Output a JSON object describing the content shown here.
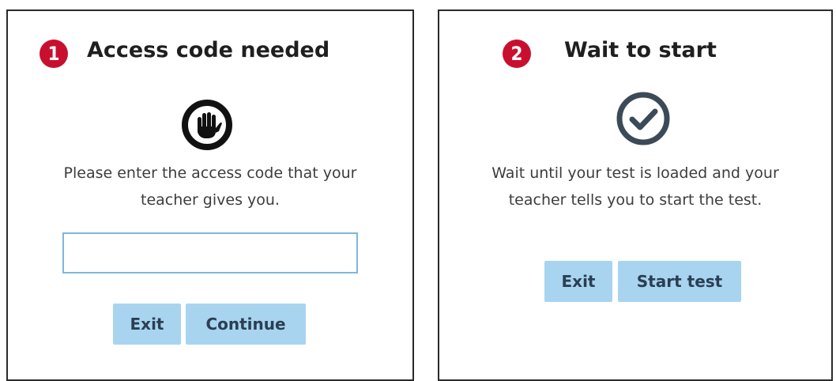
{
  "panel_1": {
    "step_number": "1",
    "title": "Access code needed",
    "icon": "hand-stop-icon",
    "message_line_1": "Please enter the access code that your",
    "message_line_2": "teacher gives you.",
    "input_value": "",
    "exit_label": "Exit",
    "continue_label": "Continue"
  },
  "panel_2": {
    "step_number": "2",
    "title": "Wait to start",
    "icon": "check-circle-icon",
    "message_line_1": "Wait until your test is loaded and your",
    "message_line_2": "teacher tells you to start the test.",
    "exit_label": "Exit",
    "start_label": "Start test"
  },
  "colors": {
    "step_badge": "#c8102e",
    "button_bg": "#a8d4f0",
    "button_text": "#2b3f52",
    "input_border": "#7fb6de",
    "check_icon": "#3c4a57"
  }
}
